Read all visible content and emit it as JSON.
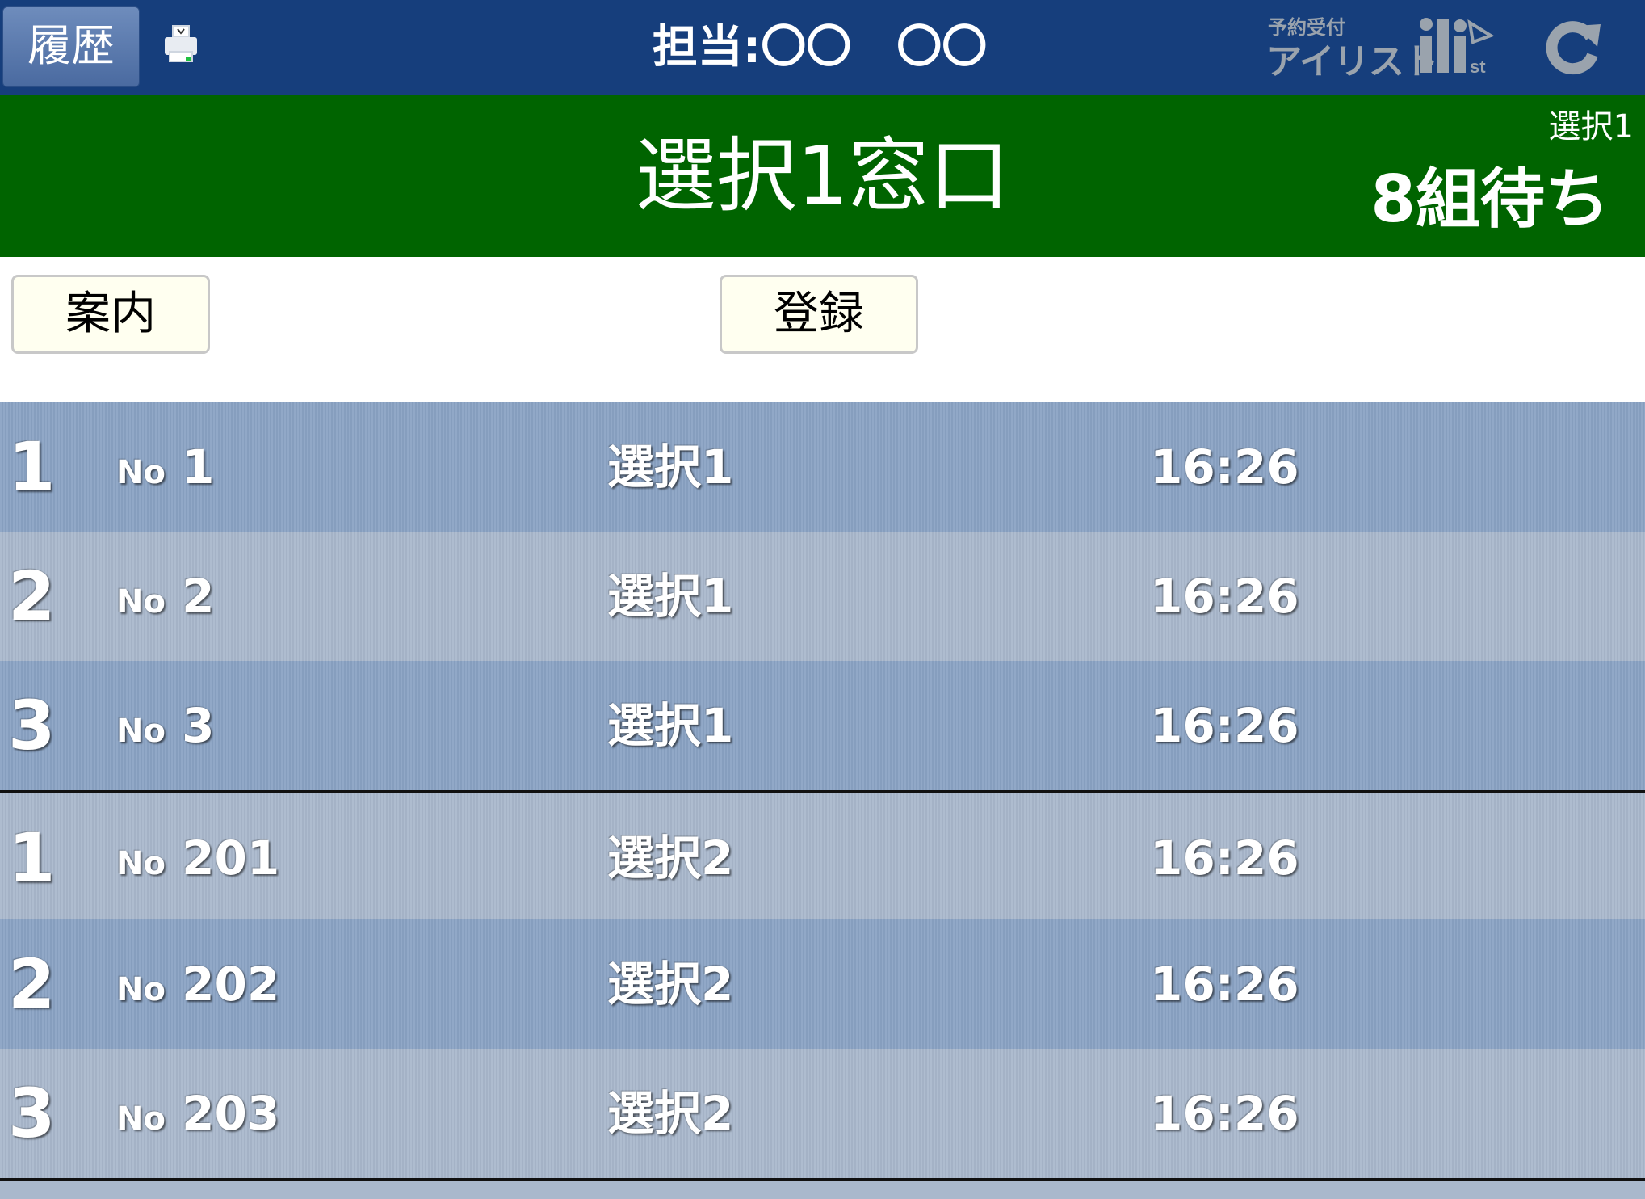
{
  "topbar": {
    "history_label": "履歴",
    "staff_label": "担当:〇〇　〇〇",
    "logo_top": "予約受付",
    "logo_main": "アイリスト"
  },
  "banner": {
    "title": "選択1窓口",
    "sub_label": "選択1",
    "waiting": "8組待ち"
  },
  "buttons": {
    "guide": "案内",
    "register": "登録"
  },
  "queue": [
    {
      "pos": "1",
      "no_prefix": "No",
      "no": "1",
      "group": "選択1",
      "time": "16:26"
    },
    {
      "pos": "2",
      "no_prefix": "No",
      "no": "2",
      "group": "選択1",
      "time": "16:26"
    },
    {
      "pos": "3",
      "no_prefix": "No",
      "no": "3",
      "group": "選択1",
      "time": "16:26"
    },
    {
      "pos": "1",
      "no_prefix": "No",
      "no": "201",
      "group": "選択2",
      "time": "16:26"
    },
    {
      "pos": "2",
      "no_prefix": "No",
      "no": "202",
      "group": "選択2",
      "time": "16:26"
    },
    {
      "pos": "3",
      "no_prefix": "No",
      "no": "203",
      "group": "選択2",
      "time": "16:26"
    }
  ],
  "colors": {
    "topbar": "#163e7c",
    "banner": "#006400",
    "row_dark": "#8aa3c4",
    "row_light": "#a9b8cc",
    "button_bg": "#fffff0"
  }
}
